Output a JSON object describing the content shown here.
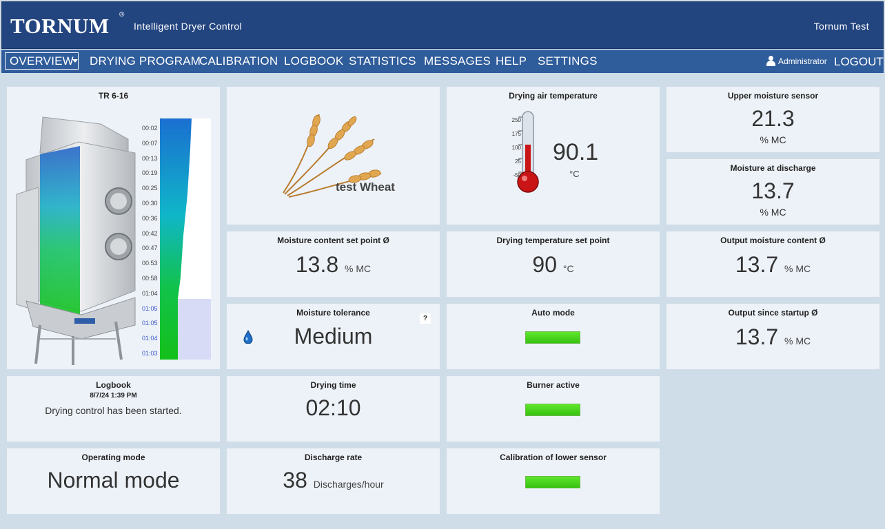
{
  "header": {
    "logo": "TORNUM",
    "logo_mark": "®",
    "subtitle": "Intelligent Dryer Control",
    "user_title": "Tornum Test"
  },
  "nav": {
    "items": [
      "OVERVIEW",
      "DRYING PROGRAM",
      "CALIBRATION",
      "LOGBOOK",
      "STATISTICS",
      "MESSAGES",
      "HELP",
      "SETTINGS"
    ],
    "active": "OVERVIEW",
    "user": "Administrator",
    "logout": "LOGOUT"
  },
  "dryer": {
    "title": "TR 6-16",
    "times": [
      "00:02",
      "00:07",
      "00:13",
      "00:19",
      "00:25",
      "00:30",
      "00:36",
      "00:42",
      "00:47",
      "00:53",
      "00:58",
      "01:04",
      "01:05",
      "01:05",
      "01:04",
      "01:03"
    ]
  },
  "grain": {
    "label": "test Wheat"
  },
  "air_temp": {
    "title": "Drying air temperature",
    "value": "90.1",
    "unit": "°C",
    "scale": [
      "250",
      "175",
      "100",
      "25",
      "-50"
    ]
  },
  "upper_moisture": {
    "title": "Upper moisture sensor",
    "value": "21.3",
    "unit": "% MC"
  },
  "moisture_discharge": {
    "title": "Moisture at discharge",
    "value": "13.7",
    "unit": "% MC"
  },
  "moisture_setpoint": {
    "title": "Moisture content set point Ø",
    "value": "13.8",
    "unit": "% MC"
  },
  "temp_setpoint": {
    "title": "Drying temperature set point",
    "value": "90",
    "unit": "°C"
  },
  "output_moisture": {
    "title": "Output moisture content Ø",
    "value": "13.7",
    "unit": "% MC"
  },
  "tolerance": {
    "title": "Moisture tolerance",
    "value": "Medium",
    "help": "?"
  },
  "auto_mode": {
    "title": "Auto mode"
  },
  "output_startup": {
    "title": "Output since startup Ø",
    "value": "13.7",
    "unit": "% MC"
  },
  "logbook": {
    "title": "Logbook",
    "date": "8/7/24 1:39 PM",
    "message": "Drying control has been started."
  },
  "drying_time": {
    "title": "Drying time",
    "value": "02:10"
  },
  "burner": {
    "title": "Burner active"
  },
  "operating_mode": {
    "title": "Operating mode",
    "value": "Normal mode"
  },
  "discharge_rate": {
    "title": "Discharge rate",
    "value": "38",
    "unit": "Discharges/hour"
  },
  "calibration": {
    "title": "Calibration of lower sensor"
  },
  "colors": {
    "header": "#23457f",
    "nav": "#2f5c9a",
    "panel": "#edf2f8",
    "indicator": "#45d21a"
  }
}
